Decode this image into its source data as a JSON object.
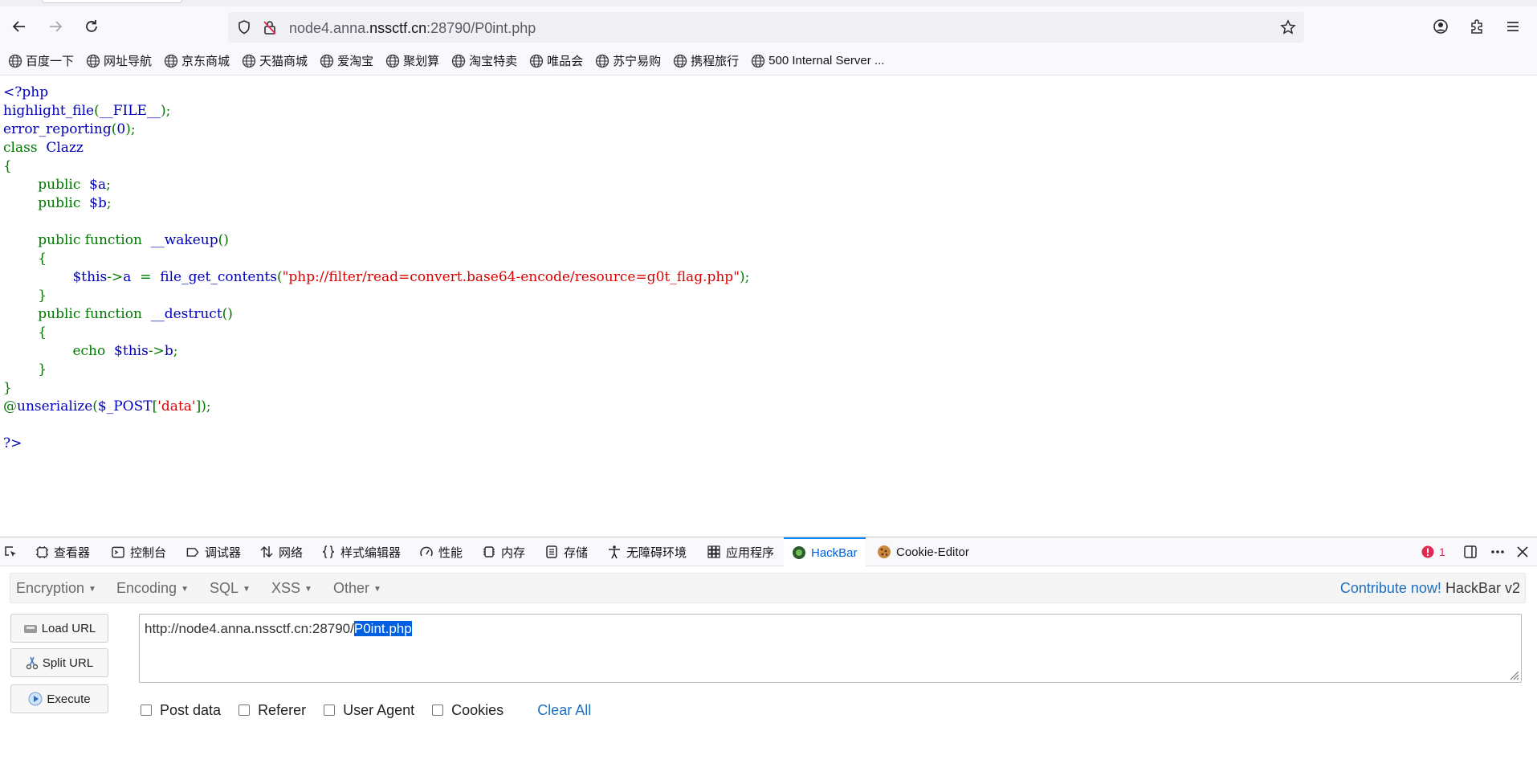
{
  "browser": {
    "url_prefix": "node4.anna.",
    "url_domain": "nssctf.cn",
    "url_suffix": ":28790/P0int.php"
  },
  "bookmarks": [
    {
      "label": "百度一下"
    },
    {
      "label": "网址导航"
    },
    {
      "label": "京东商城"
    },
    {
      "label": "天猫商城"
    },
    {
      "label": "爱淘宝"
    },
    {
      "label": "聚划算"
    },
    {
      "label": "淘宝特卖"
    },
    {
      "label": "唯品会"
    },
    {
      "label": "苏宁易购"
    },
    {
      "label": "携程旅行"
    },
    {
      "label": "500 Internal Server ..."
    }
  ],
  "code": {
    "l1": "<?php",
    "l2_fn": "highlight_file",
    "l2_p1": "(",
    "l2_arg": "__FILE__",
    "l2_p2": ");",
    "l3_fn": "error_reporting",
    "l3_p1": "(",
    "l3_arg": "0",
    "l3_p2": ");",
    "l4_kw": "class ",
    "l4_name": "Clazz",
    "l5": "{",
    "l6_kw": "public ",
    "l6_var": "$a",
    "l6_end": ";",
    "l7_kw": "public ",
    "l7_var": "$b",
    "l7_end": ";",
    "l9_kw": "public function ",
    "l9_fn": "__wakeup",
    "l9_end": "()",
    "l10": "{",
    "l11_var": "$this",
    "l11_op": "->",
    "l11_prop": "a ",
    "l11_eq": "= ",
    "l11_fn": "file_get_contents",
    "l11_p1": "(",
    "l11_str": "\"php://filter/read=convert.base64-encode/resource=g0t_flag.php\"",
    "l11_p2": ");",
    "l12": "}",
    "l13_kw": "public function ",
    "l13_fn": "__destruct",
    "l13_end": "()",
    "l14": "{",
    "l15_kw": "echo ",
    "l15_var": "$this",
    "l15_op": "->",
    "l15_prop": "b",
    "l15_end": ";",
    "l16": "}",
    "l17": "}",
    "l18_at": "@",
    "l18_fn": "unserialize",
    "l18_p1": "(",
    "l18_var": "$_POST",
    "l18_p2": "[",
    "l18_str": "'data'",
    "l18_p3": "]);",
    "l20": "?>"
  },
  "devtools": {
    "tabs": [
      {
        "label": "查看器"
      },
      {
        "label": "控制台"
      },
      {
        "label": "调试器"
      },
      {
        "label": "网络"
      },
      {
        "label": "样式编辑器"
      },
      {
        "label": "性能"
      },
      {
        "label": "内存"
      },
      {
        "label": "存储"
      },
      {
        "label": "无障碍环境"
      },
      {
        "label": "应用程序"
      },
      {
        "label": "HackBar"
      },
      {
        "label": "Cookie-Editor"
      }
    ],
    "error_count": "1"
  },
  "hackbar": {
    "menus": [
      "Encryption",
      "Encoding",
      "SQL",
      "XSS",
      "Other"
    ],
    "contribute_link": "Contribute now!",
    "version": "HackBar v2",
    "load_url": "Load URL",
    "split_url": "Split URL",
    "execute": "Execute",
    "url_plain": "http://node4.anna.nssctf.cn:28790/",
    "url_selected": "P0int.php",
    "opt_post": "Post data",
    "opt_referer": "Referer",
    "opt_ua": "User Agent",
    "opt_cookies": "Cookies",
    "clear_all": "Clear All"
  },
  "colors": {
    "php_default": "#0000bb",
    "php_keyword": "#007700",
    "php_string": "#dd0000",
    "selection": "#0060df",
    "link": "#1f6fbf"
  }
}
